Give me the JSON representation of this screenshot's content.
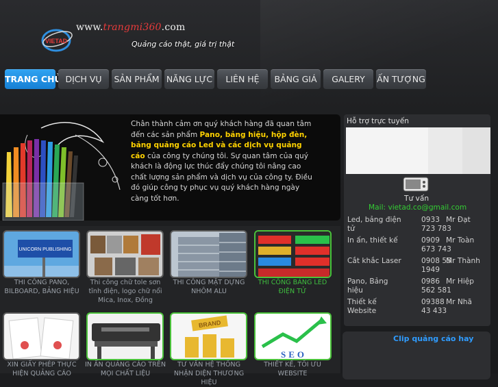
{
  "header": {
    "url_prefix": "www.",
    "url_brand": "trangmi360",
    "url_suffix": ".com",
    "slogan": "Quảng cáo thật, giá trị thật",
    "logo_text": "VIETAD"
  },
  "nav": {
    "items": [
      {
        "label": "TRANG CHỦ",
        "active": true
      },
      {
        "label": "DỊCH VỤ",
        "active": false
      },
      {
        "label": "SẢN PHẨM",
        "active": false
      },
      {
        "label": "NĂNG LỰC",
        "active": false
      },
      {
        "label": "LIÊN HỆ",
        "active": false
      },
      {
        "label": "BẢNG GIÁ",
        "active": false
      },
      {
        "label": "GALERY",
        "active": false
      },
      {
        "label": "ẤN TƯỢNG",
        "active": false
      }
    ]
  },
  "hero": {
    "text_1": "Chân thành cảm ơn quý khách hàng đã quan tâm đến các sản phẩm ",
    "text_bold": "Pano, bảng hiệu, hộp đèn, bảng quảng cáo Led và các dịch vụ quảng cáo",
    "text_2": " của công ty chúng tôi. Sự quan tâm của quý khách là động lực thúc đẩy chúng tôi nâng cao chất lượng sản phẩm và dịch vụ của công ty. Điều đó giúp công ty phục vụ quý khách hàng ngày càng tốt hơn."
  },
  "support": {
    "title": "Hỗ trợ trực tuyến",
    "tu_van": "Tư vấn",
    "mail": "Mail: vietad.co@gmail.com",
    "rows": [
      {
        "service": "Led, bảng điện tử",
        "phone": "0933 723 783",
        "name": "Mr Đạt"
      },
      {
        "service": "In ấn, thiết kế",
        "phone": "0909 673 743",
        "name": "Mr Toàn"
      },
      {
        "service": "Cắt khắc Laser",
        "phone": "0908 55 1949",
        "name": "Mr Thành"
      },
      {
        "service": "Pano, Bảng hiệu",
        "phone": "0986 562 581",
        "name": "Mr Hiệp"
      },
      {
        "service": "Thiết kế Website",
        "phone": "09388 43 433",
        "name": "Mr Nhã"
      }
    ]
  },
  "clip": {
    "title": "Clip quảng cáo hay"
  },
  "products": [
    {
      "caption": "THI CÔNG PANO, BILBOARD, BẢNG HIỆU",
      "image_label": "UNICORN PUBLISHING"
    },
    {
      "caption": "Thi công chữ tole sơn tĩnh điện, logo chữ nổi Mica, Inox, Đồng",
      "image_label": ""
    },
    {
      "caption": "THI CÔNG MẶT DỰNG NHÔM ALU",
      "image_label": ""
    },
    {
      "caption": "THI CÔNG BẢNG LED ĐIỆN TỬ",
      "image_label": ""
    },
    {
      "caption": "XIN GIẤY PHÉP THỰC HIỆN QUẢNG CÁO",
      "image_label": ""
    },
    {
      "caption": "IN ẤN QUẢNG CÁO TRÊN MỌI CHẤT LIỆU",
      "image_label": ""
    },
    {
      "caption": "TƯ VẤN HỆ THỐNG NHẬN DIỆN THƯƠNG HIỆU",
      "image_label": "BRAND"
    },
    {
      "caption": "THIẾT KẾ, TỐI ƯU WEBSITE",
      "image_label": "SEO"
    }
  ],
  "colors": {
    "accent": "#1680d4",
    "highlight_text": "#ffd200",
    "mail_green": "#33cc33",
    "clip_blue": "#2f9cff"
  }
}
